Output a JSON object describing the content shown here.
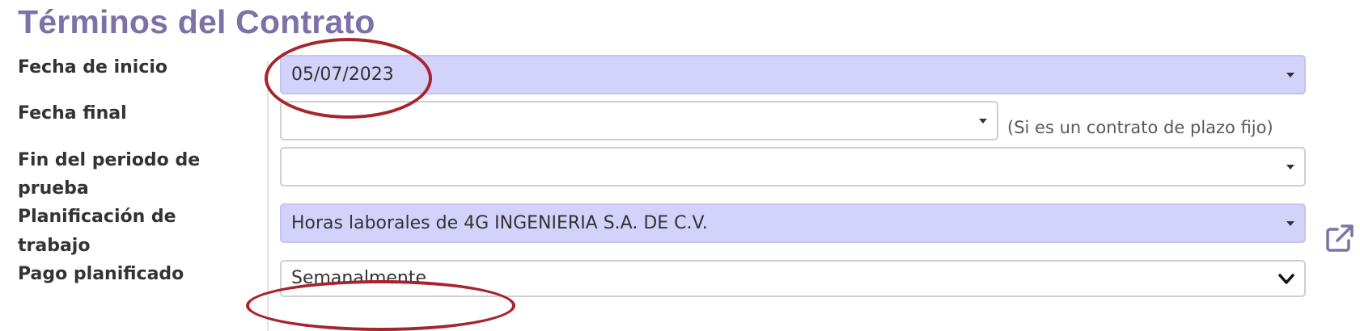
{
  "section": {
    "title": "Términos del Contrato"
  },
  "fields": {
    "start_date": {
      "label": "Fecha de inicio",
      "value": "05/07/2023"
    },
    "end_date": {
      "label": "Fecha final",
      "value": "",
      "hint": "(Si es un contrato de plazo fijo)"
    },
    "trial_end": {
      "label_line1": "Fin del periodo de",
      "label_line2": "prueba",
      "value": ""
    },
    "work_schedule": {
      "label_line1": "Planificación de",
      "label_line2": "trabajo",
      "value": "Horas laborales de 4G INGENIERIA S.A. DE C.V."
    },
    "scheduled_pay": {
      "label": "Pago planificado",
      "value": "Semanalmente"
    }
  },
  "colors": {
    "title": "#7d72a8",
    "required_field_bg": "#d2d2fb",
    "annotation_oval": "#a8232b",
    "link_icon": "#7d72a8"
  },
  "icons": {
    "dropdown": "caret-down-icon",
    "select": "chevron-down-icon",
    "external_link": "external-link-icon"
  }
}
